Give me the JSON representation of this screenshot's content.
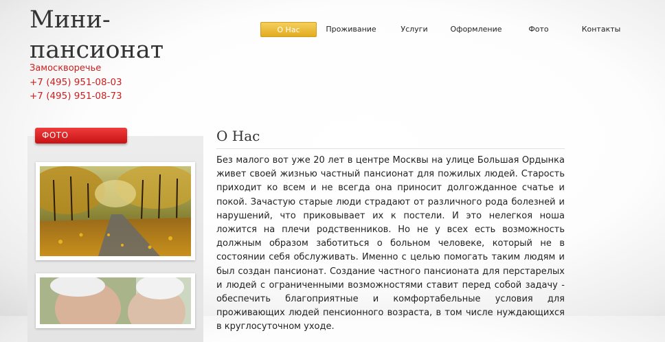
{
  "site": {
    "title": "Мини-пансионат",
    "district": "Замоскворечье",
    "phones": [
      "+7 (495) 951-08-03",
      "+7 (495) 951-08-73"
    ]
  },
  "nav": {
    "items": [
      "О Нас",
      "Проживание",
      "Услуги",
      "Оформление",
      "Фото",
      "Контакты"
    ],
    "active_index": 0
  },
  "sidebar": {
    "tab_label": "ФОТО",
    "photos": [
      "autumn-park-photo",
      "elderly-couple-photo"
    ]
  },
  "main": {
    "heading": "О Нас",
    "body": "Без малого вот уже 20 лет в центре Москвы на улице Большая Ордынка живет своей жизнью частный пансионат для пожилых людей. Старость приходит ко всем и не всегда она приносит долгожданное счатье и покой. Зачастую старые люди страдают от различного рода болезней и нарушений, что приковывает их к постели. И это нелегкоя ноша ложится на плечи родственников. Но не у всех есть возможность должным образом заботиться о больном человеке, который не в состоянии себя обслуживать. Именно с целью помогать таким людям и был создан пансионат. Создание частного пансионата для перстарелых и людей с ограниченными возможностями ставит перед собой задачу - обеспечить благоприятные и комфортабельные условия для проживающих людей пенсионного возраста, в том числе нуждающихся в круглосуточном уходе."
  },
  "colors": {
    "accent_red": "#cc1f1f",
    "nav_active": "#e2ac1f",
    "tab_red": "#d91e1e"
  }
}
